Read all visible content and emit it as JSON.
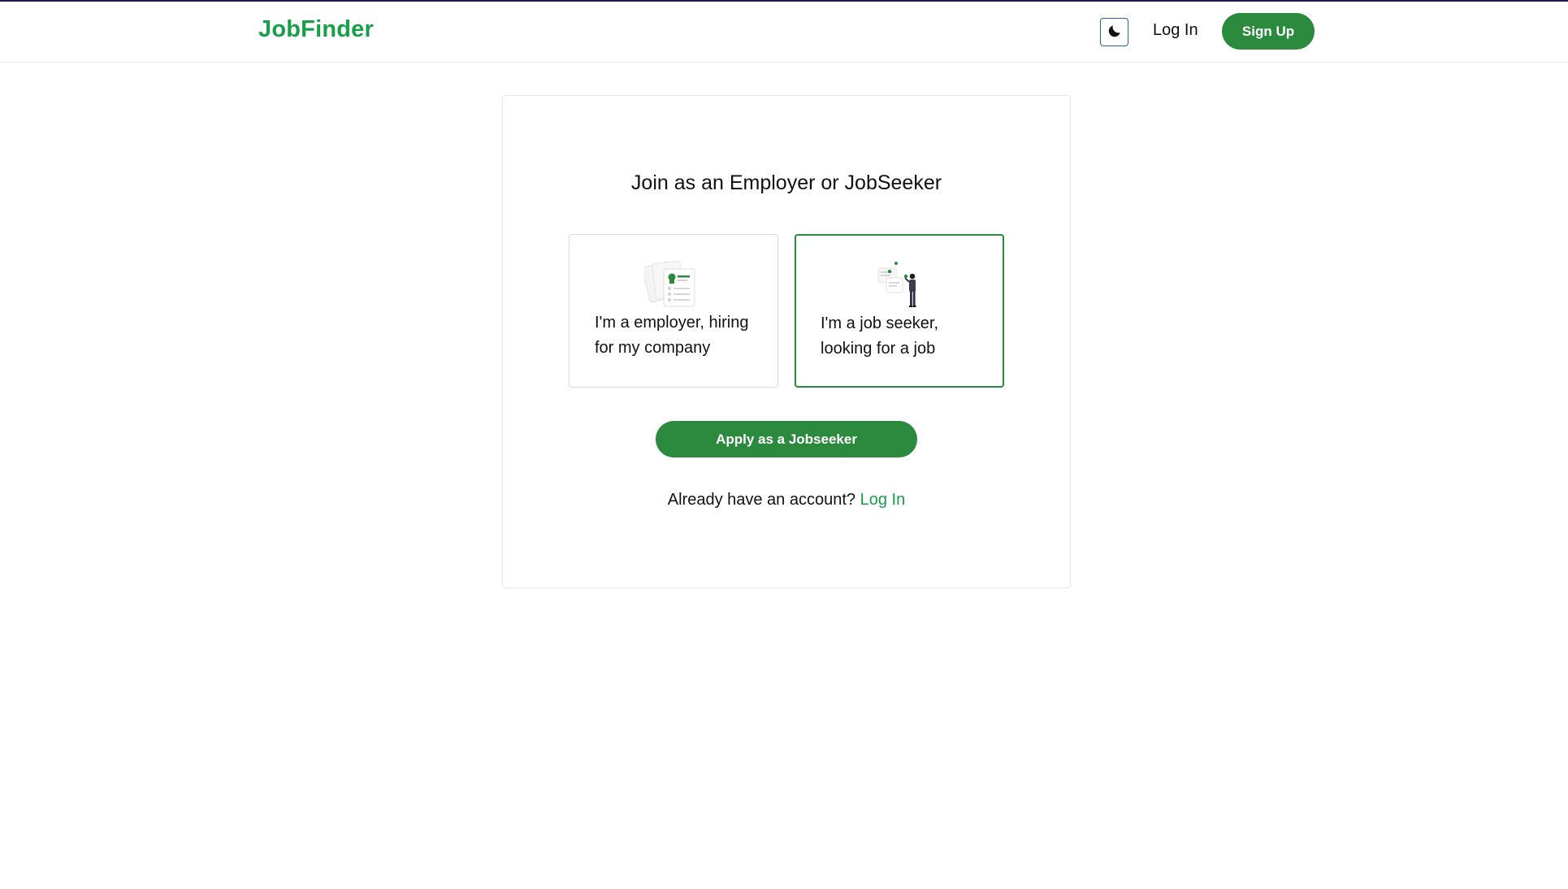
{
  "colors": {
    "brand": "#1a9e4b",
    "primary_button": "#2b8a3e",
    "top_line": "#1e1b4b",
    "toggle_border": "#2f5fa8"
  },
  "header": {
    "brand": "JobFinder",
    "theme_toggle_icon": "moon-icon",
    "login_label": "Log In",
    "signup_label": "Sign Up"
  },
  "main": {
    "title": "Join as an Employer or JobSeeker",
    "options": [
      {
        "icon": "resume-documents-icon",
        "label": "I'm a employer, hiring for my company",
        "selected": false
      },
      {
        "icon": "person-with-documents-icon",
        "label": "I'm a job seeker, looking for a job",
        "selected": true
      }
    ],
    "apply_button_label": "Apply as a Jobseeker",
    "account_prompt": "Already have an account?",
    "login_link": "Log In"
  }
}
